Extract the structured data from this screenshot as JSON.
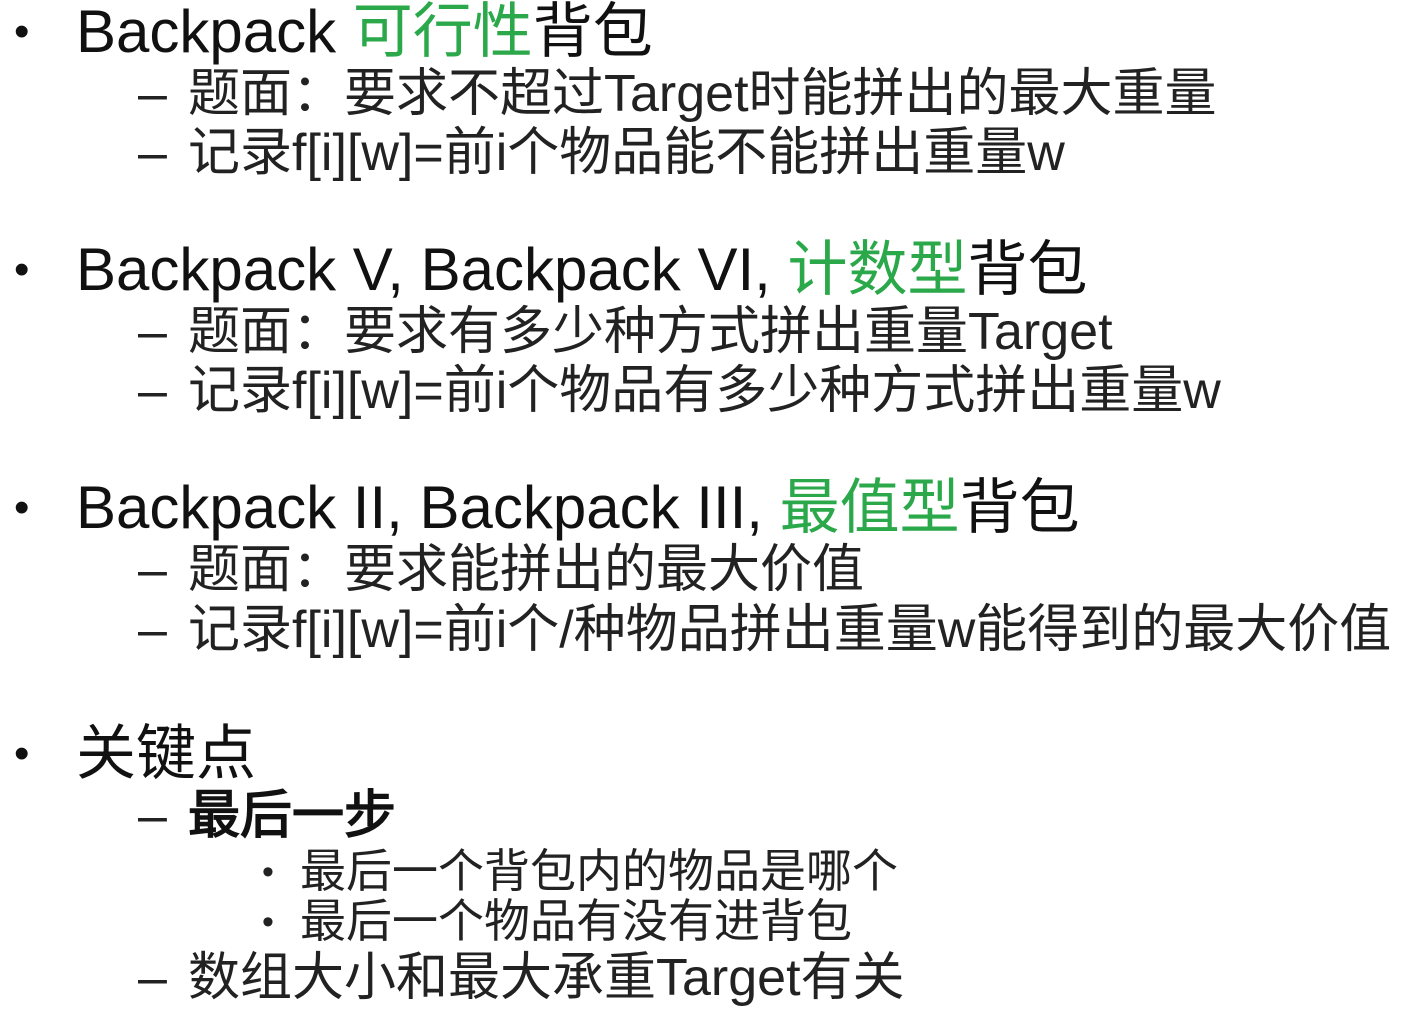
{
  "bullet_glyph": "•",
  "dash_glyph": "–",
  "accent_color": "#2aa84a",
  "sections": [
    {
      "title_prefix": "Backpack ",
      "title_highlight": "可行性",
      "title_suffix": "背包",
      "items": [
        "题面：要求不超过Target时能拼出的最大重量",
        "记录f[i][w]=前i个物品能不能拼出重量w"
      ]
    },
    {
      "title_prefix": "Backpack V, Backpack VI, ",
      "title_highlight": "计数型",
      "title_suffix": "背包",
      "items": [
        "题面：要求有多少种方式拼出重量Target",
        "记录f[i][w]=前i个物品有多少种方式拼出重量w"
      ]
    },
    {
      "title_prefix": "Backpack II, Backpack III, ",
      "title_highlight": "最值型",
      "title_suffix": "背包",
      "items": [
        "题面：要求能拼出的最大价值",
        "记录f[i][w]=前i个/种物品拼出重量w能得到的最大价值"
      ]
    },
    {
      "title": "关键点",
      "key_step": "最后一步",
      "sub_items": [
        "最后一个背包内的物品是哪个",
        "最后一个物品有没有进背包"
      ],
      "last_item": "数组大小和最大承重Target有关"
    }
  ]
}
